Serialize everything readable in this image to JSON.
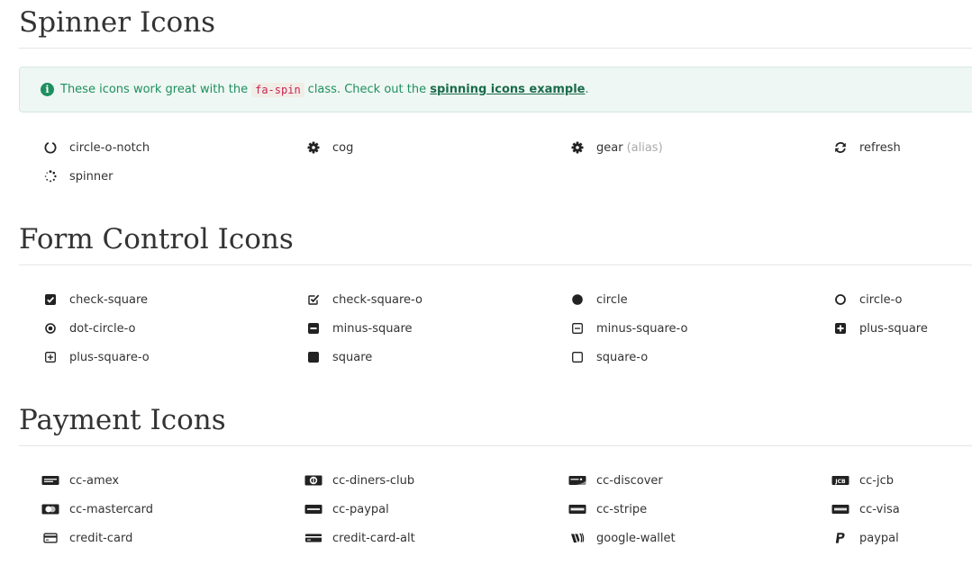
{
  "spinner_section": {
    "title": "Spinner Icons",
    "alert": {
      "before": "These icons work great with the",
      "code": "fa-spin",
      "middle": "class. Check out the",
      "link": "spinning icons example",
      "after": "."
    },
    "items": [
      {
        "label": "circle-o-notch",
        "icon": "circle-o-notch-icon"
      },
      {
        "label": "cog",
        "icon": "cog-icon"
      },
      {
        "label": "gear",
        "alias": "(alias)",
        "icon": "gear-icon"
      },
      {
        "label": "refresh",
        "icon": "refresh-icon"
      },
      {
        "label": "spinner",
        "icon": "spinner-icon"
      }
    ]
  },
  "form_section": {
    "title": "Form Control Icons",
    "items": [
      {
        "label": "check-square",
        "icon": "check-square-icon"
      },
      {
        "label": "check-square-o",
        "icon": "check-square-o-icon"
      },
      {
        "label": "circle",
        "icon": "circle-icon"
      },
      {
        "label": "circle-o",
        "icon": "circle-o-icon"
      },
      {
        "label": "dot-circle-o",
        "icon": "dot-circle-o-icon"
      },
      {
        "label": "minus-square",
        "icon": "minus-square-icon"
      },
      {
        "label": "minus-square-o",
        "icon": "minus-square-o-icon"
      },
      {
        "label": "plus-square",
        "icon": "plus-square-icon"
      },
      {
        "label": "plus-square-o",
        "icon": "plus-square-o-icon"
      },
      {
        "label": "square",
        "icon": "square-icon"
      },
      {
        "label": "square-o",
        "icon": "square-o-icon"
      }
    ]
  },
  "payment_section": {
    "title": "Payment Icons",
    "items": [
      {
        "label": "cc-amex",
        "icon": "cc-amex-icon"
      },
      {
        "label": "cc-diners-club",
        "icon": "cc-diners-club-icon"
      },
      {
        "label": "cc-discover",
        "icon": "cc-discover-icon"
      },
      {
        "label": "cc-jcb",
        "icon": "cc-jcb-icon"
      },
      {
        "label": "cc-mastercard",
        "icon": "cc-mastercard-icon"
      },
      {
        "label": "cc-paypal",
        "icon": "cc-paypal-icon"
      },
      {
        "label": "cc-stripe",
        "icon": "cc-stripe-icon"
      },
      {
        "label": "cc-visa",
        "icon": "cc-visa-icon"
      },
      {
        "label": "credit-card",
        "icon": "credit-card-icon"
      },
      {
        "label": "credit-card-alt",
        "icon": "credit-card-alt-icon"
      },
      {
        "label": "google-wallet",
        "icon": "google-wallet-icon"
      },
      {
        "label": "paypal",
        "icon": "paypal-icon"
      }
    ]
  },
  "colors": {
    "alert_background": "#eef7f3",
    "alert_text": "#1f8f60",
    "code_text": "#c7254e",
    "icon": "#222222"
  }
}
